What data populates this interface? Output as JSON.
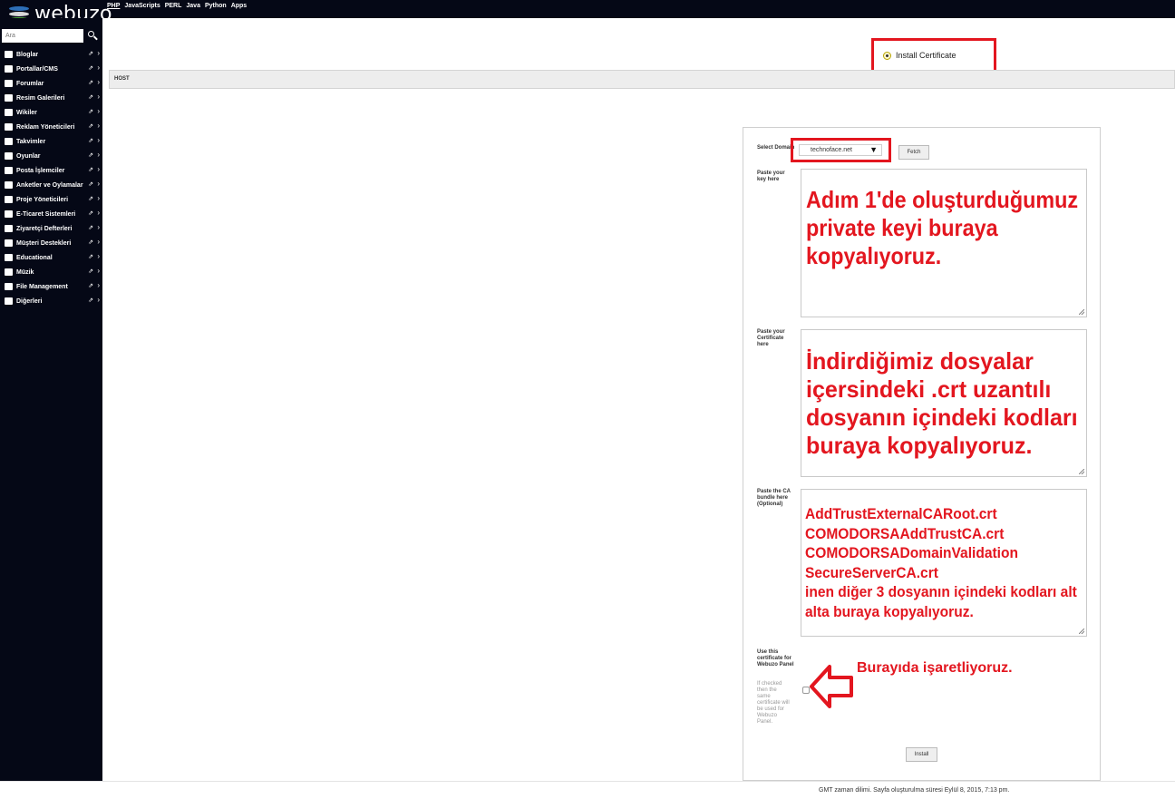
{
  "brand": {
    "name": "webuzo"
  },
  "topnav": {
    "items": [
      "PHP",
      "JavaScripts",
      "PERL",
      "Java",
      "Python",
      "Apps"
    ]
  },
  "sidebar": {
    "search_placeholder": "Ara",
    "items": [
      {
        "label": "Bloglar",
        "icon": "user-icon"
      },
      {
        "label": "Portallar/CMS",
        "icon": "monitor-icon"
      },
      {
        "label": "Forumlar",
        "icon": "users-icon"
      },
      {
        "label": "Resim Galerileri",
        "icon": "image-icon"
      },
      {
        "label": "Wikiler",
        "icon": "globe-icon"
      },
      {
        "label": "Reklam Yöneticileri",
        "icon": "megaphone-icon"
      },
      {
        "label": "Takvimler",
        "icon": "calendar-icon"
      },
      {
        "label": "Oyunlar",
        "icon": "gamepad-icon"
      },
      {
        "label": "Posta İşlemciler",
        "icon": "envelope-icon"
      },
      {
        "label": "Anketler ve Oylamalar",
        "icon": "poll-icon"
      },
      {
        "label": "Proje Yöneticileri",
        "icon": "edit-icon"
      },
      {
        "label": "E-Ticaret Sistemleri",
        "icon": "cart-icon"
      },
      {
        "label": "Ziyaretçi Defterleri",
        "icon": "book-icon"
      },
      {
        "label": "Müşteri Destekleri",
        "icon": "lifebuoy-icon"
      },
      {
        "label": "Educational",
        "icon": "graduation-cap-icon"
      },
      {
        "label": "Müzik",
        "icon": "music-icon"
      },
      {
        "label": "File Management",
        "icon": "file-icon"
      },
      {
        "label": "Diğerleri",
        "icon": "folder-icon"
      }
    ]
  },
  "main": {
    "install_tab_label": "Install Certificate",
    "host_label": "HOST",
    "form": {
      "domain_label": "Select Domain",
      "domain_value": "technoface.net",
      "fetch_label": "Fetch",
      "key_label": "Paste your key here",
      "key_annotation": [
        "Adım 1'de oluşturduğumuz",
        "private keyi buraya",
        "kopyalıyoruz."
      ],
      "cert_label": "Paste your Certificate here",
      "cert_annotation": [
        "İndirdiğimiz dosyalar",
        "içersindeki .crt uzantılı",
        "dosyanın içindeki kodları",
        "buraya kopyalıyoruz."
      ],
      "ca_label": "Paste the CA bundle here (Optional)",
      "ca_annotation": [
        " AddTrustExternalCARoot.crt",
        " COMODORSAAddTrustCA.crt",
        " COMODORSADomainValidation",
        " SecureServerCA.crt",
        "inen diğer 3 dosyanın içindeki kodları alt",
        "alta buraya kopyalıyoruz."
      ],
      "webuzo_label": "Use this certificate for Webuzo Panel",
      "webuzo_hint": "If checked then the same certificate will be used for Webuzo Panel.",
      "checkbox_annotation": "Burayıda işaretliyoruz.",
      "install_label": "Install"
    }
  },
  "footer": {
    "text": "GMT zaman dilimi. Sayfa oluşturulma süresi Eylül 8, 2015, 7:13 pm."
  },
  "colors": {
    "sidebar_bg": "#050816",
    "annotation_red": "#e3161f"
  }
}
